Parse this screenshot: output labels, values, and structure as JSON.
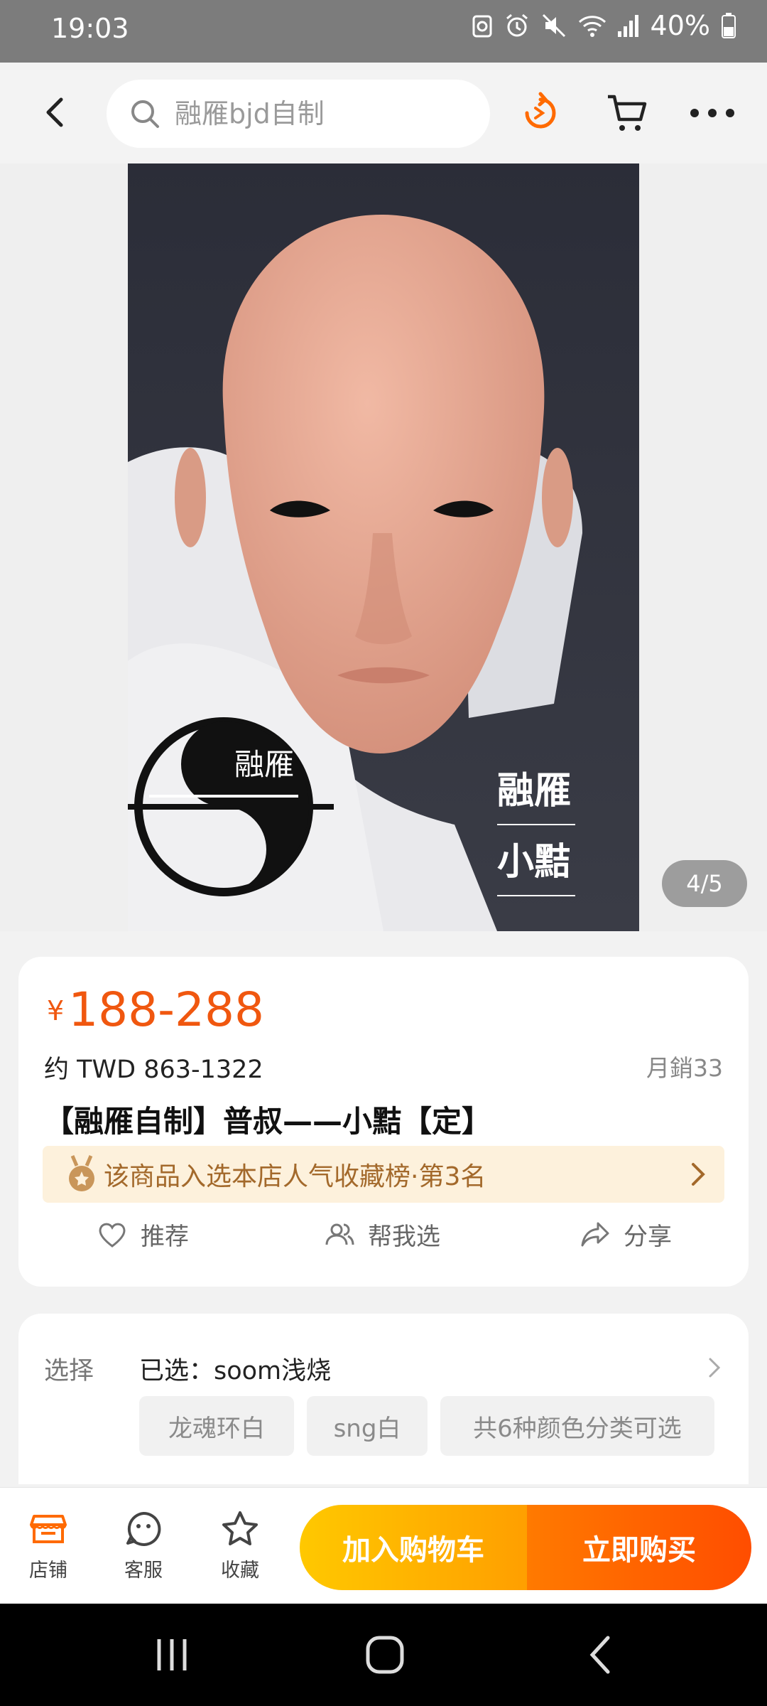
{
  "status_bar": {
    "time": "19:03",
    "battery": "40%"
  },
  "search": {
    "placeholder": "融雁bjd自制"
  },
  "gallery": {
    "counter": "4/5",
    "logo_text": "融雁",
    "watermark_line1": "融雁",
    "watermark_line2": "小黠"
  },
  "product": {
    "currency_symbol": "¥",
    "price_range": "188-288",
    "approx_price": "约 TWD 863-1322",
    "monthly_sales": "月銷33",
    "title": "【融雁自制】普叔——小黠【定】",
    "rank_banner": "该商品入选本店人气收藏榜·第3名",
    "actions": {
      "recommend": "推荐",
      "help_choose": "帮我选",
      "share": "分享"
    }
  },
  "selection": {
    "label": "选择",
    "selected": "已选：soom浅烧",
    "chips": [
      "龙魂环白",
      "sng白",
      "共6种颜色分类可选"
    ]
  },
  "bottom_bar": {
    "shop": "店铺",
    "service": "客服",
    "favorite": "收藏",
    "add_to_cart": "加入购物车",
    "buy_now": "立即购买"
  },
  "colors": {
    "accent": "#f0570f",
    "cart_button": "#ffb300",
    "buy_button": "#ff5a00",
    "banner_bg": "#fdf1dc"
  }
}
